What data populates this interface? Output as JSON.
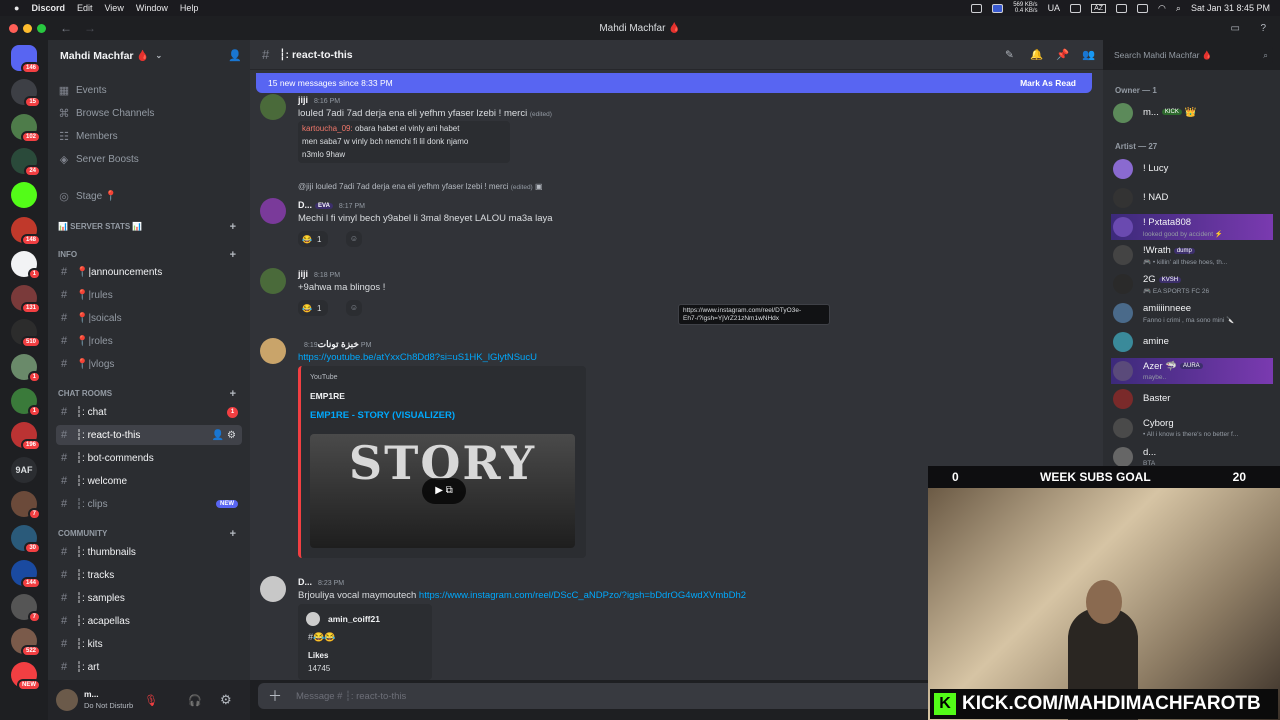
{
  "menubar": {
    "app": "Discord",
    "items": [
      "Edit",
      "View",
      "Window",
      "Help"
    ],
    "net_up": "569 KB/s",
    "net_down": "0.4 KB/s",
    "input": "UA",
    "az": "AZ",
    "clock": "Sat Jan 31  8:45 PM"
  },
  "window": {
    "title": "Mahdi Machfar 🩸"
  },
  "guilds": [
    {
      "badge": "146",
      "color": "#5865f2"
    },
    {
      "badge": "15",
      "color": "#3d3f45"
    },
    {
      "badge": "102",
      "color": "#4e7c4a"
    },
    {
      "badge": "24",
      "color": "#2a4a3a"
    },
    {
      "badge": "",
      "color": "#53fc18"
    },
    {
      "badge": "148",
      "color": "#c0392b"
    },
    {
      "badge": "1",
      "color": "#f2f3f5"
    },
    {
      "badge": "131",
      "color": "#7a3a3a"
    },
    {
      "badge": "510",
      "color": "#2c2c2c"
    },
    {
      "badge": "1",
      "color": "#6a8a6a"
    },
    {
      "badge": "1",
      "color": "#3a7a3a"
    },
    {
      "badge": "196",
      "color": "#b33"
    },
    {
      "badge": "",
      "color": "#2b2d31",
      "text": "9AF"
    },
    {
      "badge": "7",
      "color": "#6b4a3a"
    },
    {
      "badge": "30",
      "color": "#2a5a7a"
    },
    {
      "badge": "144",
      "color": "#1a4aa0"
    },
    {
      "badge": "7",
      "color": "#555"
    },
    {
      "badge": "522",
      "color": "#7a5a4a"
    },
    {
      "badge": "NEW",
      "color": "#f23f42"
    }
  ],
  "server": {
    "name": "Mahdi Machfar 🩸"
  },
  "channels": {
    "top": [
      "Events",
      "Browse Channels",
      "Members",
      "Server Boosts"
    ],
    "stage": "Stage 📍",
    "stats": "📊 SERVER STATS 📊",
    "info_cat": "INFO",
    "info": [
      "📍|announcements",
      "📍|rules",
      "📍|soicals",
      "📍|roles",
      "📍|vlogs"
    ],
    "chat_cat": "CHAT ROOMS",
    "chat": [
      {
        "name": "┆: chat",
        "badge": "1"
      },
      {
        "name": "┆: react-to-this"
      },
      {
        "name": "┆: bot-commends"
      },
      {
        "name": "┆: welcome"
      },
      {
        "name": "┆: clips",
        "badge": "NEW"
      }
    ],
    "community_cat": "COMMUNITY",
    "community": [
      "┆: thumbnails",
      "┆: tracks",
      "┆: samples",
      "┆: acapellas",
      "┆: kits",
      "┆: art"
    ]
  },
  "user": {
    "name": "m...",
    "status": "Do Not Disturb"
  },
  "header": {
    "channel": "┆: react-to-this",
    "search_placeholder": "Search Mahdi Machfar 🩸"
  },
  "newbar": {
    "text": "15 new messages since 8:33 PM",
    "mark": "Mark As Read"
  },
  "messages": [
    {
      "author": "jiji",
      "time": "8:16 PM",
      "text": "louled 7adi 7ad derja ena eli yefhm yfaser lzebi ! merci",
      "edited": "(edited)",
      "quote_author": "kartoucha_09:",
      "quote_lines": [
        "obara habet el vinly ani habet",
        "men saba7 w vinly bch nemchi fi lil donk njamo",
        "n3mlo 9haw"
      ]
    },
    {
      "reply": "@jiji louled 7adi 7ad derja ena eli yefhm yfaser lzebi ! merci",
      "reply_edited": "(edited)",
      "author": "D...",
      "tag": "EVA",
      "time": "8:17 PM",
      "text": "Mechi l fi vinyl bech y9abel li 3mal 8neyet LALOU ma3a laya",
      "reaction": "😂",
      "count": "1"
    },
    {
      "author": "jiji",
      "time": "8:18 PM",
      "text": "+9ahwa ma blingos !",
      "reaction": "😂",
      "count": "1"
    },
    {
      "author": "خبزة تونات",
      "time": "8:19 PM",
      "link": "https://youtube.be/atYxxCh8Dd8?si=uS1HK_lGlytNSucU",
      "embed": {
        "provider": "YouTube",
        "author": "EMP1RE",
        "title": "EMP1RE - STORY (VISUALIZER)",
        "thumb_text": "STORY"
      }
    },
    {
      "author": "D...",
      "time": "8:23 PM",
      "text": "Brjouliya vocal maymoutech ",
      "link": "https://www.instagram.com/reel/DScC_aNDPzo/?igsh=bDdrOG4wdXVmbDh2",
      "embed": {
        "author": "amin_coiff21",
        "body": "#😂😂",
        "likes_label": "Likes",
        "likes": "14745"
      }
    }
  ],
  "tooltip": {
    "line1": "https://www.instagram.com/reel/DTyO3e-",
    "line2": "Eh7-/?igsh=YjVrZ21zNm1wNHdx"
  },
  "composer": {
    "placeholder": "Message # ┆: react-to-this"
  },
  "members": {
    "owner_label": "Owner — 1",
    "owner": {
      "name": "m...",
      "tag": "KICK",
      "color": "#5c8a5a"
    },
    "artist_label": "Artist — 27",
    "artists": [
      {
        "name": "! Lucy",
        "status": "",
        "color": "#8a6ad0"
      },
      {
        "name": "! NAD",
        "status": "",
        "color": "#333"
      },
      {
        "name": "! Pxtata808",
        "status": "looked good by accident ⚡",
        "color": "#6a4ab0"
      },
      {
        "name": "!Wrath",
        "tag": "dump",
        "status": "🎮 • killin' all these hoes, th...",
        "color": "#444"
      },
      {
        "name": "2G",
        "tag": "KVSH",
        "status": "🎮 EA SPORTS FC 26",
        "color": "#2a2a2a"
      },
      {
        "name": "amiiiinneee",
        "status": "Fanno i crimi , ma sono mini 🔪",
        "color": "#4a6a8a"
      },
      {
        "name": "amine",
        "status": "",
        "color": "#3a8a9a"
      },
      {
        "name": "Azer 🦈",
        "tag": "AURA",
        "status": "maybe..",
        "color": "#5a4a7a"
      },
      {
        "name": "Baster",
        "status": "",
        "color": "#7a2a2a"
      },
      {
        "name": "Cyborg",
        "status": "• All i know is there's no better f...",
        "color": "#4a4a4a"
      },
      {
        "name": "d...",
        "status": "BTA",
        "color": "#666"
      }
    ]
  },
  "overlay": {
    "goal_left": "0",
    "goal_label": "WEEK SUBS GOAL",
    "goal_right": "20",
    "kick_url": "KICK.COM/MAHDIMACHFAROTB"
  }
}
